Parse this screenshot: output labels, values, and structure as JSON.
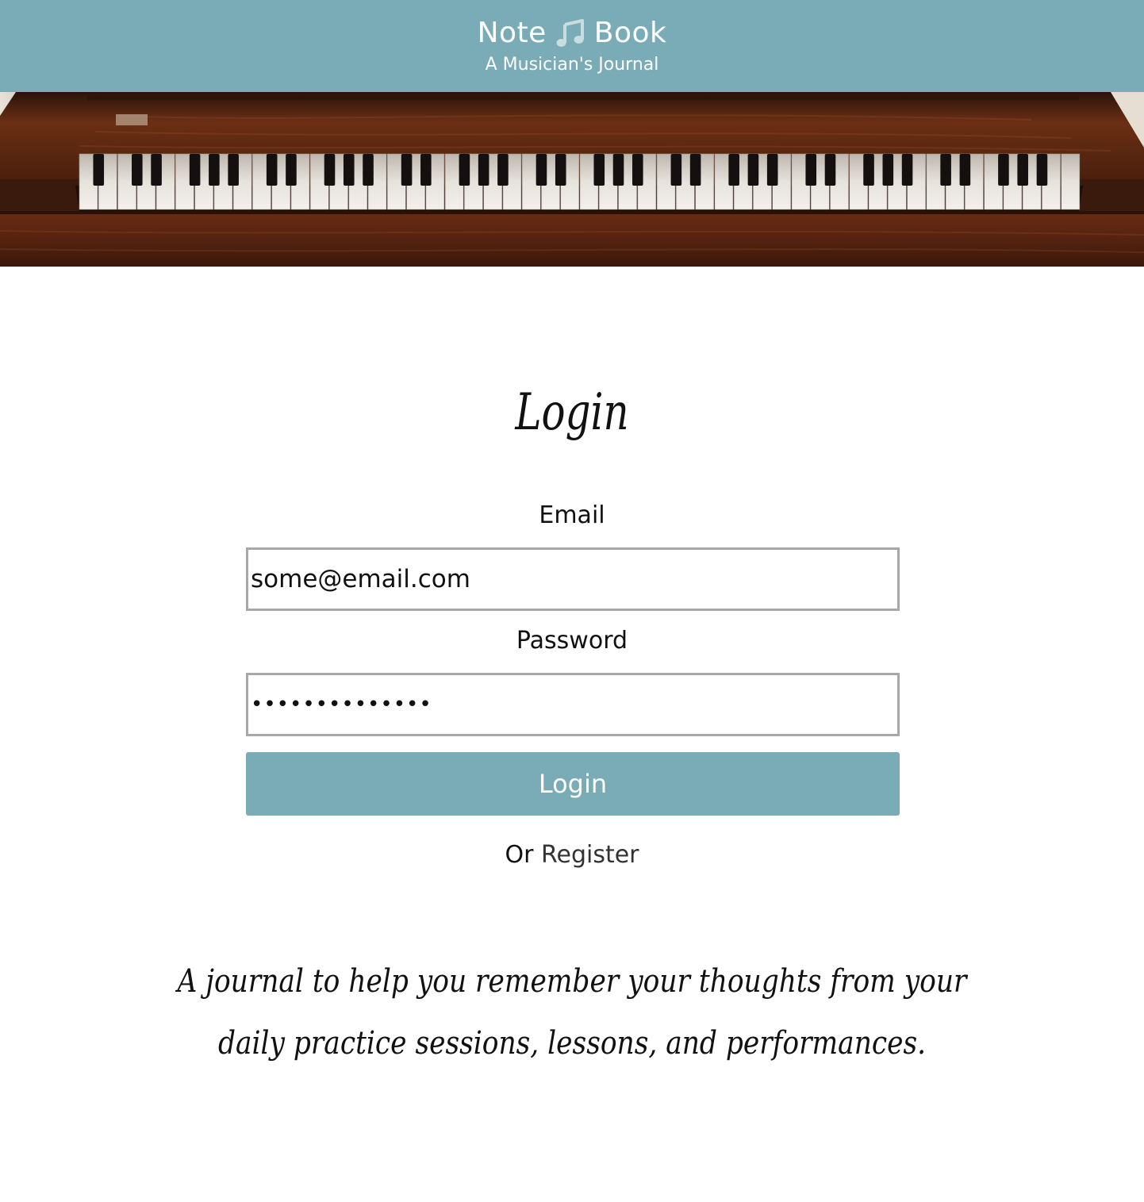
{
  "header": {
    "brand_left": "Note",
    "brand_right": "Book",
    "brand_icon": "music-note-icon",
    "tagline": "A Musician's Journal",
    "background_color": "#79acb6"
  },
  "hero": {
    "image": "piano-keyboard-banner"
  },
  "login_form": {
    "title": "Login",
    "email_label": "Email",
    "email_value": "some@email.com",
    "password_label": "Password",
    "password_value": "••••••••••••••",
    "submit_label": "Login",
    "or_text": "Or",
    "register_link": "Register"
  },
  "description": "A journal to help you remember your thoughts from your daily practice sessions, lessons, and performances."
}
